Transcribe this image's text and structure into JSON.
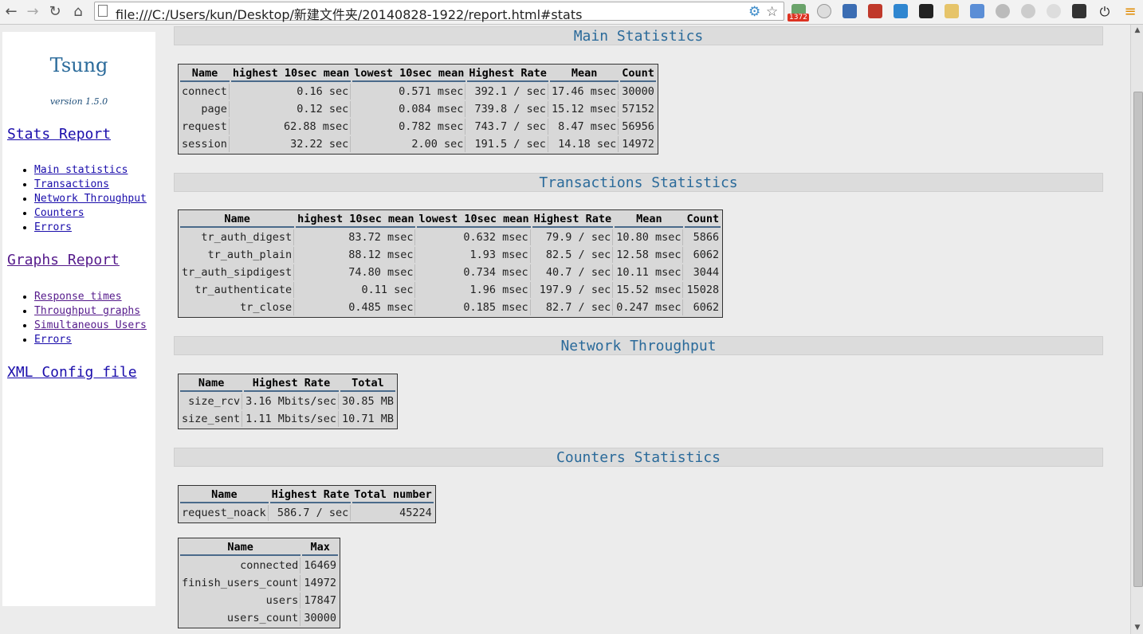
{
  "browser": {
    "url": "file:///C:/Users/kun/Desktop/新建文件夹/20140828-1922/report.html#stats",
    "badge_count": "1372"
  },
  "sidebar": {
    "brand": "Tsung",
    "version": "version 1.5.0",
    "stats_report": "Stats Report",
    "stats_items": [
      "Main statistics",
      "Transactions",
      "Network Throughput",
      "Counters",
      "Errors"
    ],
    "graphs_report": "Graphs Report",
    "graphs_items": [
      "Response times",
      "Throughput graphs",
      "Simultaneous Users",
      "Errors"
    ],
    "xml_config": "XML Config file"
  },
  "sections": {
    "main": "Main Statistics",
    "transactions": "Transactions Statistics",
    "network": "Network Throughput",
    "counters": "Counters Statistics"
  },
  "main_table": {
    "headers": [
      "Name",
      "highest 10sec mean",
      "lowest 10sec mean",
      "Highest Rate",
      "Mean",
      "Count"
    ],
    "rows": [
      [
        "connect",
        "0.16 sec",
        "0.571 msec",
        "392.1 / sec",
        "17.46 msec",
        "30000"
      ],
      [
        "page",
        "0.12 sec",
        "0.084 msec",
        "739.8 / sec",
        "15.12 msec",
        "57152"
      ],
      [
        "request",
        "62.88 msec",
        "0.782 msec",
        "743.7 / sec",
        "8.47 msec",
        "56956"
      ],
      [
        "session",
        "32.22 sec",
        "2.00 sec",
        "191.5 / sec",
        "14.18 sec",
        "14972"
      ]
    ]
  },
  "transactions_table": {
    "headers": [
      "Name",
      "highest 10sec mean",
      "lowest 10sec mean",
      "Highest Rate",
      "Mean",
      "Count"
    ],
    "rows": [
      [
        "tr_auth_digest",
        "83.72 msec",
        "0.632 msec",
        "79.9 / sec",
        "10.80 msec",
        "5866"
      ],
      [
        "tr_auth_plain",
        "88.12 msec",
        "1.93 msec",
        "82.5 / sec",
        "12.58 msec",
        "6062"
      ],
      [
        "tr_auth_sipdigest",
        "74.80 msec",
        "0.734 msec",
        "40.7 / sec",
        "10.11 msec",
        "3044"
      ],
      [
        "tr_authenticate",
        "0.11 sec",
        "1.96 msec",
        "197.9 / sec",
        "15.52 msec",
        "15028"
      ],
      [
        "tr_close",
        "0.485 msec",
        "0.185 msec",
        "82.7 / sec",
        "0.247 msec",
        "6062"
      ]
    ]
  },
  "network_table": {
    "headers": [
      "Name",
      "Highest Rate",
      "Total"
    ],
    "rows": [
      [
        "size_rcv",
        "3.16 Mbits/sec",
        "30.85 MB"
      ],
      [
        "size_sent",
        "1.11 Mbits/sec",
        "10.71 MB"
      ]
    ]
  },
  "counters_table": {
    "headers": [
      "Name",
      "Highest Rate",
      "Total number"
    ],
    "rows": [
      [
        "request_noack",
        "586.7 / sec",
        "45224"
      ]
    ]
  },
  "max_table": {
    "headers": [
      "Name",
      "Max"
    ],
    "rows": [
      [
        "connected",
        "16469"
      ],
      [
        "finish_users_count",
        "14972"
      ],
      [
        "users",
        "17847"
      ],
      [
        "users_count",
        "30000"
      ]
    ]
  }
}
